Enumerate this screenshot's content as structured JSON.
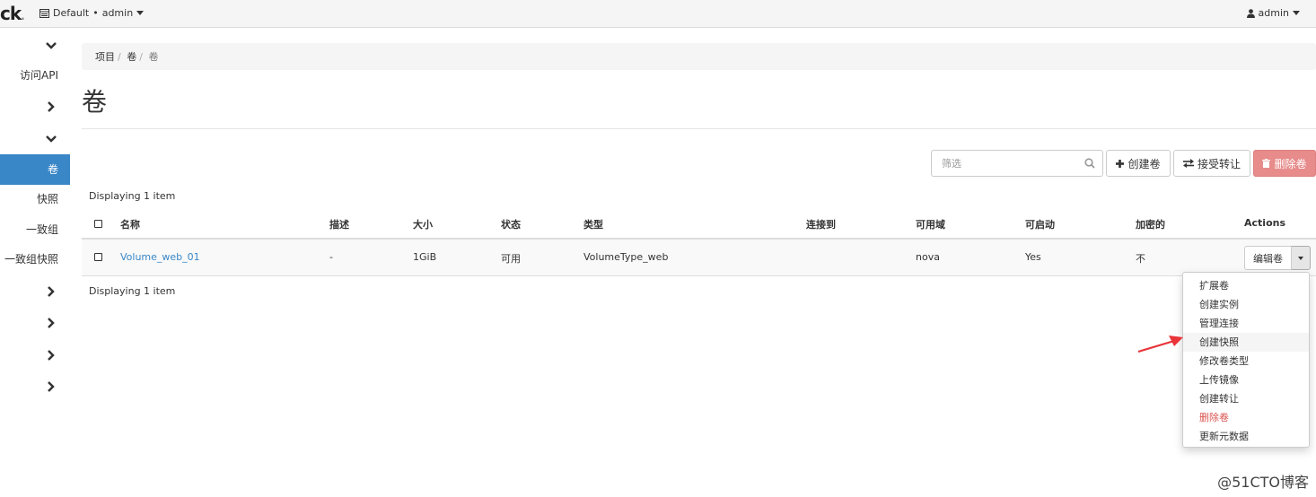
{
  "topbar": {
    "brand": "ck",
    "project_label": "Default",
    "project_user": "admin",
    "user_label": "admin"
  },
  "sidebar": {
    "items": [
      {
        "label": "访问API"
      },
      {
        "label": "卷",
        "active": true
      },
      {
        "label": "快照"
      },
      {
        "label": "一致组"
      },
      {
        "label": "一致组快照"
      }
    ]
  },
  "breadcrumb": {
    "items": [
      "项目",
      "卷",
      "卷"
    ]
  },
  "page": {
    "title": "卷"
  },
  "actions": {
    "filter_placeholder": "筛选",
    "create_label": "创建卷",
    "transfer_label": "接受转让",
    "delete_label": "删除卷"
  },
  "table": {
    "count_text": "Displaying 1 item",
    "columns": [
      "名称",
      "描述",
      "大小",
      "状态",
      "类型",
      "连接到",
      "可用域",
      "可启动",
      "加密的",
      "Actions"
    ],
    "rows": [
      {
        "name": "Volume_web_01",
        "description": "-",
        "size": "1GiB",
        "status": "可用",
        "type": "VolumeType_web",
        "attached_to": "",
        "zone": "nova",
        "bootable": "Yes",
        "encrypted": "不",
        "action_label": "编辑卷"
      }
    ]
  },
  "dropdown": {
    "items": [
      {
        "label": "扩展卷"
      },
      {
        "label": "创建实例"
      },
      {
        "label": "管理连接"
      },
      {
        "label": "创建快照",
        "highlighted": true
      },
      {
        "label": "修改卷类型"
      },
      {
        "label": "上传镜像"
      },
      {
        "label": "创建转让"
      },
      {
        "label": "删除卷",
        "danger": true
      },
      {
        "label": "更新元数据"
      }
    ]
  },
  "watermark": "@51CTO博客",
  "colors": {
    "accent": "#3a87c8",
    "danger": "#d9534f",
    "arrow": "#e8343a"
  }
}
